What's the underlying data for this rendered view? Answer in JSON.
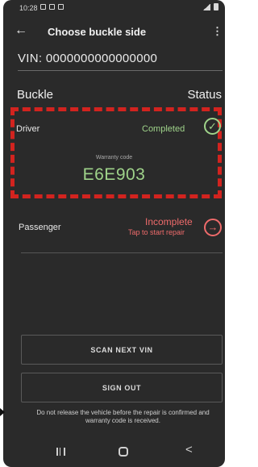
{
  "status_bar": {
    "time": "10:28",
    "icons": [
      "gallery-icon",
      "play-icon",
      "app-icon"
    ],
    "right_icons": [
      "mute-icon",
      "wifi-icon",
      "signal-icon",
      "battery-icon"
    ]
  },
  "appbar": {
    "back_icon": "←",
    "title": "Choose buckle side",
    "menu_icon": "⋮"
  },
  "vin": {
    "text": "VIN: 0000000000000000"
  },
  "columns": {
    "buckle": "Buckle",
    "status": "Status"
  },
  "driver": {
    "label": "Driver",
    "status": "Completed",
    "status_icon": "✓",
    "warranty_label": "Warranty code",
    "warranty_code": "E6E903"
  },
  "passenger": {
    "label": "Passenger",
    "status": "Incomplete",
    "sub": "Tap to start repair",
    "status_icon": "→"
  },
  "buttons": {
    "scan_next": "SCAN NEXT VIN",
    "sign_out": "SIGN OUT"
  },
  "warning": "Do not release the vehicle before the repair is confirmed and warranty code is received.",
  "navbar": {
    "back_glyph": "<"
  },
  "colors": {
    "background": "#2a2a2a",
    "completed": "#9fd38a",
    "incomplete": "#ef6b6b",
    "highlight_border": "#d2231f"
  }
}
